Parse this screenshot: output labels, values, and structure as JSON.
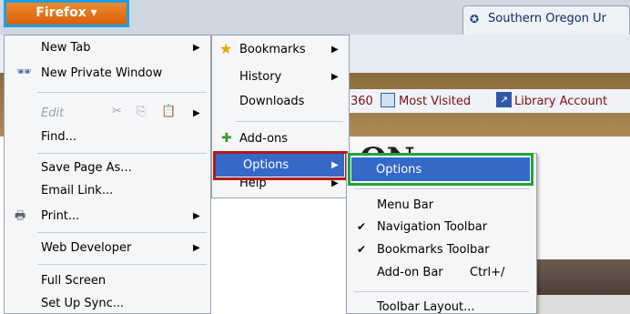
{
  "tab": {
    "title": "Southern Oregon Ur"
  },
  "bookmarks_toolbar": {
    "items": [
      "360",
      "Most Visited",
      "Library Account"
    ]
  },
  "page": {
    "heading": "ON"
  },
  "firefox_button": {
    "label": "Firefox ▾"
  },
  "main_menu": {
    "new_tab": "New Tab",
    "new_private_window": "New Private Window",
    "edit": "Edit",
    "find": "Find...",
    "save_page_as": "Save Page As...",
    "email_link": "Email Link...",
    "print": "Print...",
    "web_developer": "Web Developer",
    "full_screen": "Full Screen",
    "set_up_sync": "Set Up Sync..."
  },
  "sub_menu": {
    "bookmarks": "Bookmarks",
    "history": "History",
    "downloads": "Downloads",
    "add_ons": "Add-ons",
    "options": "Options",
    "help": "Help"
  },
  "options_menu": {
    "options": "Options",
    "menu_bar": "Menu Bar",
    "navigation_toolbar": "Navigation Toolbar",
    "bookmarks_toolbar": "Bookmarks Toolbar",
    "add_on_bar": "Add-on Bar",
    "add_on_bar_shortcut": "Ctrl+/",
    "toolbar_layout": "Toolbar Layout..."
  },
  "colors": {
    "firefox_orange": "#e8731a",
    "highlight": "#3569c8",
    "red_outline": "#b01a1a",
    "green_outline": "#21a33a",
    "blue_outline": "#1aa0e6"
  },
  "icons": [
    "private-window-icon",
    "cut-icon",
    "copy-icon",
    "paste-icon",
    "printer-icon",
    "star-icon",
    "puzzle-icon",
    "check-icon"
  ]
}
